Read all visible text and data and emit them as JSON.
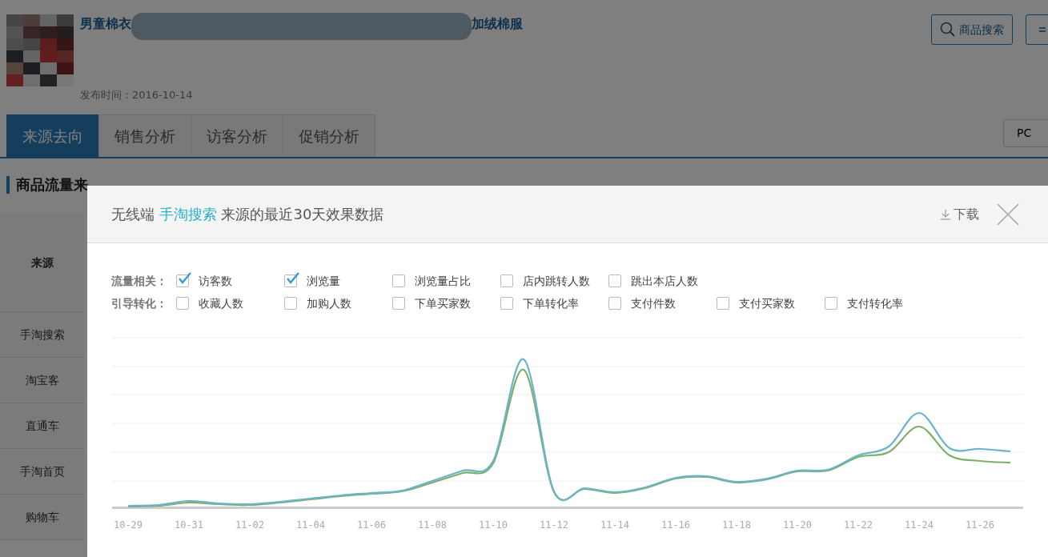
{
  "product": {
    "kind": "picture",
    "title_start": "男童棉衣",
    "title_end": "加绒棉服",
    "publish_label": "发布时间：",
    "publish_date": "2016-10-14"
  },
  "header_buttons": [
    {
      "kind": "search",
      "label": "商品搜索"
    },
    {
      "kind": "partial"
    }
  ],
  "tabs": [
    {
      "label": "来源去向",
      "selected": true
    },
    {
      "label": "销售分析",
      "selected": false
    },
    {
      "label": "访客分析",
      "selected": false
    },
    {
      "label": "促销分析",
      "selected": false
    }
  ],
  "device_button": "PC",
  "section_title": "商品流量来",
  "table": {
    "header": "来源",
    "rows": [
      "手淘搜索",
      "淘宝客",
      "直通车",
      "手淘首页",
      "购物车"
    ]
  },
  "dialog": {
    "title": {
      "before": "无线端",
      "source": "手淘搜索",
      "after": "来源的最近30天效果数据"
    },
    "download": "下载",
    "metric_groups": [
      {
        "label": "流量相关：",
        "items": [
          {
            "label": "访客数",
            "checked": true
          },
          {
            "label": "浏览量",
            "checked": true
          },
          {
            "label": "浏览量占比",
            "checked": false
          },
          {
            "label": "店内跳转人数",
            "checked": false
          },
          {
            "label": "跳出本店人数",
            "checked": false
          }
        ]
      },
      {
        "label": "引导转化：",
        "items": [
          {
            "label": "收藏人数",
            "checked": false
          },
          {
            "label": "加购人数",
            "checked": false
          },
          {
            "label": "下单买家数",
            "checked": false
          },
          {
            "label": "下单转化率",
            "checked": false
          },
          {
            "label": "支付件数",
            "checked": false
          },
          {
            "label": "支付买家数",
            "checked": false
          },
          {
            "label": "支付转化率",
            "checked": false
          }
        ]
      }
    ],
    "chart": {
      "x_labels": [
        "10-29",
        "10-31",
        "11-02",
        "11-04",
        "11-06",
        "11-08",
        "11-10",
        "11-12",
        "11-14",
        "11-16",
        "11-18",
        "11-20",
        "11-22",
        "11-24",
        "11-26"
      ]
    }
  }
}
